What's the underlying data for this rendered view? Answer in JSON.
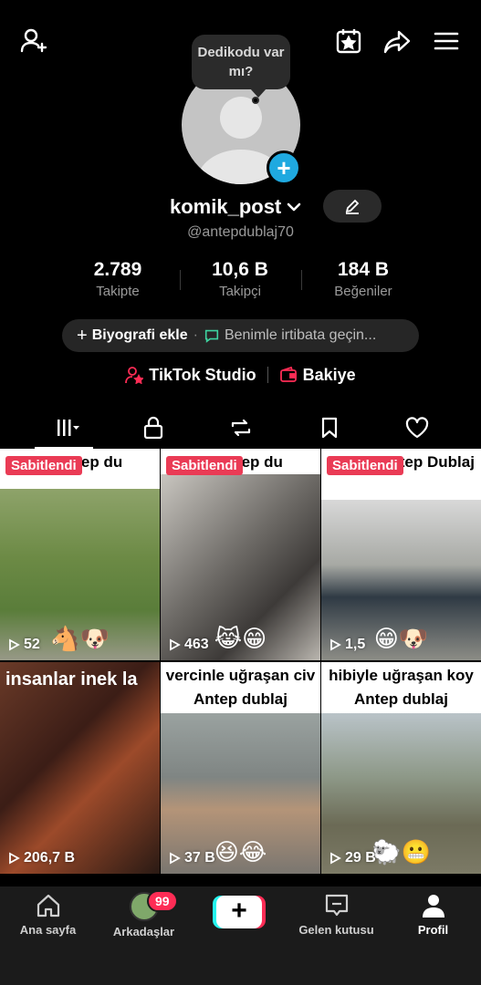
{
  "topbar": {
    "add_friend_icon": "add-user-icon",
    "calendar_icon": "calendar-star-icon",
    "share_icon": "share-arrow-icon",
    "menu_icon": "hamburger-menu-icon"
  },
  "bubble": {
    "text": "Dedikodu var mı?"
  },
  "profile": {
    "username": "komik_post",
    "handle": "@antepdublaj70",
    "edit_icon": "pencil-icon"
  },
  "stats": [
    {
      "value": "2.789",
      "label": "Takipte"
    },
    {
      "value": "10,6 B",
      "label": "Takipçi"
    },
    {
      "value": "184 B",
      "label": "Beğeniler"
    }
  ],
  "bio": {
    "add_label": "Biyografi ekle",
    "contact_label": "Benimle irtibata geçin..."
  },
  "tools": {
    "studio": "TikTok Studio",
    "balance": "Bakiye"
  },
  "tabs": [
    "videos",
    "private",
    "reposts",
    "favorites",
    "liked"
  ],
  "colors": {
    "accent_red": "#fe2c55",
    "pin_red": "#ea3b55",
    "accent_cyan": "#25f4ee",
    "badge_blue": "#1fa9e0"
  },
  "videos": [
    {
      "caption": "k -Antep du",
      "pinned": "Sabitlendi",
      "views": "52",
      "emoji": "🐴🐶"
    },
    {
      "caption": "di Antep du",
      "pinned": "Sabitlendi",
      "views": "463",
      "emoji": "😹😁"
    },
    {
      "caption": "Çocuk Antep Dublaj",
      "pinned": "Sabitlendi",
      "views": "1,5",
      "emoji": "😁🐶"
    },
    {
      "caption": "insanlar inek la",
      "pinned": "",
      "views": "206,7 B",
      "emoji": ""
    },
    {
      "caption": "vercinle uğraşan civ Antep dublaj",
      "pinned": "",
      "views": "37 B",
      "emoji": "😆😂"
    },
    {
      "caption": "hibiyle uğraşan koy Antep dublaj",
      "pinned": "",
      "views": "29 B",
      "emoji": "🐑😬"
    }
  ],
  "bottom_nav": {
    "home": "Ana sayfa",
    "friends": "Arkadaşlar",
    "friends_badge": "99",
    "inbox": "Gelen kutusu",
    "profile": "Profil"
  }
}
